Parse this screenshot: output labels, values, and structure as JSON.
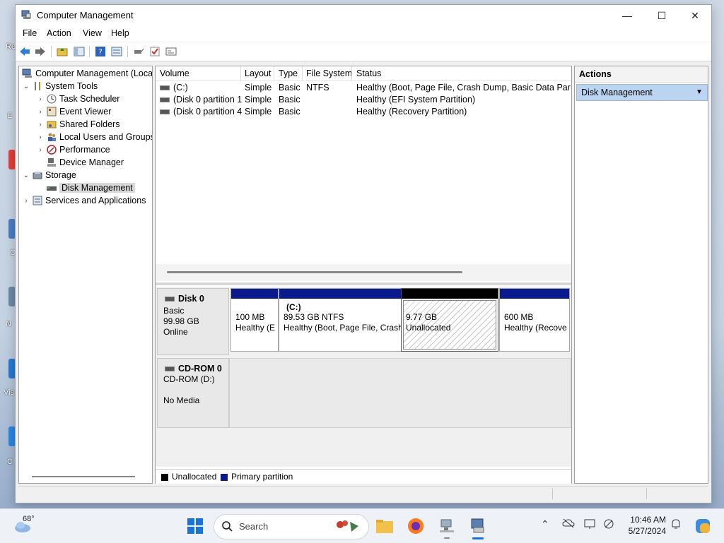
{
  "window": {
    "title": "Computer Management",
    "controls": {
      "minimize": "—",
      "maximize": "☐",
      "close": "✕"
    }
  },
  "menu": [
    "File",
    "Action",
    "View",
    "Help"
  ],
  "toolbar": [
    "back-icon",
    "forward-icon",
    "up-folder-icon",
    "show-hide-tree-icon",
    "help-icon",
    "console-tree-icon",
    "connect-icon",
    "checklist-icon",
    "properties-icon"
  ],
  "tree": {
    "root": "Computer Management (Local",
    "system_tools": "System Tools",
    "task_scheduler": "Task Scheduler",
    "event_viewer": "Event Viewer",
    "shared_folders": "Shared Folders",
    "local_users": "Local Users and Groups",
    "performance": "Performance",
    "device_manager": "Device Manager",
    "storage": "Storage",
    "disk_management": "Disk Management",
    "services": "Services and Applications"
  },
  "volumes": {
    "headers": {
      "volume": "Volume",
      "layout": "Layout",
      "type": "Type",
      "fs": "File System",
      "status": "Status"
    },
    "rows": [
      {
        "volume": "(C:)",
        "layout": "Simple",
        "type": "Basic",
        "fs": "NTFS",
        "status": "Healthy (Boot, Page File, Crash Dump, Basic Data Partition)"
      },
      {
        "volume": "(Disk 0 partition 1)",
        "layout": "Simple",
        "type": "Basic",
        "fs": "",
        "status": "Healthy (EFI System Partition)"
      },
      {
        "volume": "(Disk 0 partition 4)",
        "layout": "Simple",
        "type": "Basic",
        "fs": "",
        "status": "Healthy (Recovery Partition)"
      }
    ]
  },
  "disk0": {
    "name": "Disk 0",
    "type": "Basic",
    "size": "99.98 GB",
    "state": "Online",
    "partitions": [
      {
        "title": "",
        "size": "100 MB",
        "status": "Healthy (E"
      },
      {
        "title": "(C:)",
        "size": "89.53 GB NTFS",
        "status": "Healthy (Boot, Page File, Crash"
      },
      {
        "title": "",
        "size": "9.77 GB",
        "status": "Unallocated"
      },
      {
        "title": "",
        "size": "600 MB",
        "status": "Healthy (Recove"
      }
    ]
  },
  "cdrom": {
    "name": "CD-ROM 0",
    "drive": "CD-ROM (D:)",
    "media": "No Media"
  },
  "legend": {
    "unallocated": "Unallocated",
    "primary": "Primary partition"
  },
  "actions": {
    "header": "Actions",
    "item": "Disk Management"
  },
  "taskbar": {
    "weather": "68°",
    "search_placeholder": "Search",
    "time": "10:46 AM",
    "date": "5/27/2024"
  },
  "colors": {
    "primary_partition": "#0a1a8c",
    "unallocated": "#000000",
    "selection": "#bad4f2"
  }
}
